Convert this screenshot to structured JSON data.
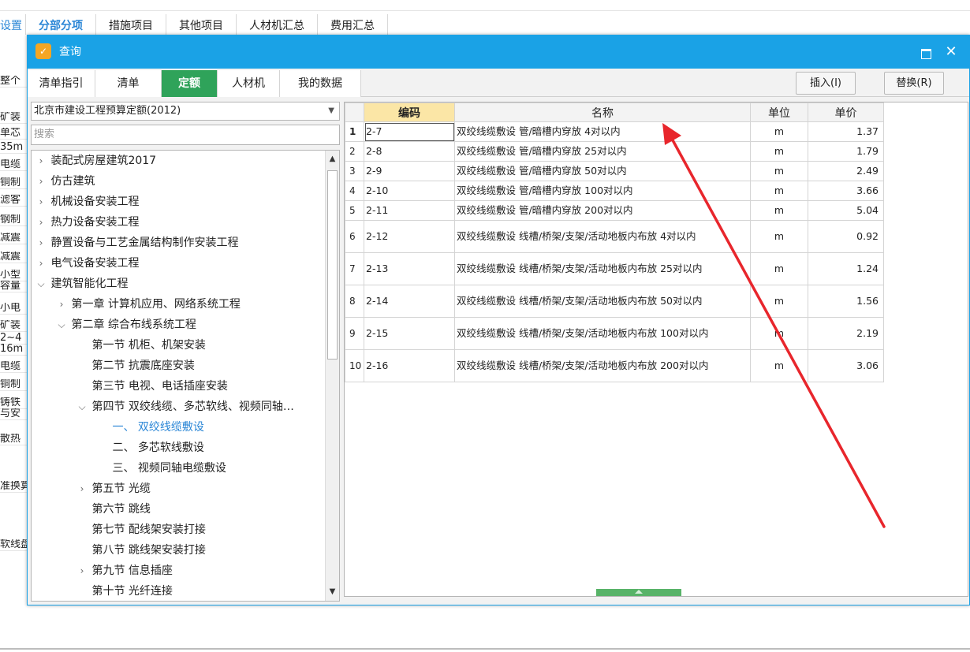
{
  "background": {
    "tabs": [
      "设置",
      "分部分项",
      "措施项目",
      "其他项目",
      "人材机汇总",
      "费用汇总"
    ],
    "active_tab": "分部分项",
    "left_cells": [
      "整个",
      "矿装",
      "单芯",
      "35m",
      "电缆",
      "铜制",
      "滤客",
      "钢制",
      "减震",
      "减震",
      "小型",
      "容量",
      "小电",
      "矿装",
      "2~4",
      "16m",
      "电缆",
      "铜制",
      "铸铁",
      "与安",
      "散热",
      "准换算",
      "软线盘"
    ]
  },
  "dialog": {
    "title": "查询",
    "app_icon": "app-logo-icon",
    "tabs": [
      "清单指引",
      "清单",
      "定额",
      "人材机",
      "我的数据"
    ],
    "active_tab": "定额",
    "insert_button": "插入(I)",
    "replace_button": "替换(R)",
    "quota_library": "北京市建设工程预算定额(2012)",
    "search_placeholder": "搜索",
    "tree": [
      {
        "label": "装配式房屋建筑2017",
        "indent": 0,
        "toggle": ">"
      },
      {
        "label": "仿古建筑",
        "indent": 0,
        "toggle": ">"
      },
      {
        "label": "机械设备安装工程",
        "indent": 0,
        "toggle": ">"
      },
      {
        "label": "热力设备安装工程",
        "indent": 0,
        "toggle": ">"
      },
      {
        "label": "静置设备与工艺金属结构制作安装工程",
        "indent": 0,
        "toggle": ">"
      },
      {
        "label": "电气设备安装工程",
        "indent": 0,
        "toggle": ">"
      },
      {
        "label": "建筑智能化工程",
        "indent": 0,
        "toggle": "v"
      },
      {
        "label": "第一章 计算机应用、网络系统工程",
        "indent": 1,
        "toggle": ">"
      },
      {
        "label": "第二章 综合布线系统工程",
        "indent": 1,
        "toggle": "v"
      },
      {
        "label": "第一节 机柜、机架安装",
        "indent": 2,
        "toggle": ""
      },
      {
        "label": "第二节 抗震底座安装",
        "indent": 2,
        "toggle": ""
      },
      {
        "label": "第三节 电视、电话插座安装",
        "indent": 2,
        "toggle": ""
      },
      {
        "label": "第四节 双绞线缆、多芯软线、视频同轴…",
        "indent": 2,
        "toggle": "v"
      },
      {
        "label": "一、 双绞线缆敷设",
        "indent": 3,
        "toggle": "",
        "selected": true
      },
      {
        "label": "二、 多芯软线敷设",
        "indent": 3,
        "toggle": ""
      },
      {
        "label": "三、 视频同轴电缆敷设",
        "indent": 3,
        "toggle": ""
      },
      {
        "label": "第五节 光缆",
        "indent": 2,
        "toggle": ">"
      },
      {
        "label": "第六节 跳线",
        "indent": 2,
        "toggle": ""
      },
      {
        "label": "第七节 配线架安装打接",
        "indent": 2,
        "toggle": ""
      },
      {
        "label": "第八节 跳线架安装打接",
        "indent": 2,
        "toggle": ""
      },
      {
        "label": "第九节 信息插座",
        "indent": 2,
        "toggle": ">"
      },
      {
        "label": "第十节 光纤连接",
        "indent": 2,
        "toggle": ""
      }
    ],
    "grid": {
      "columns": [
        "",
        "编码",
        "名称",
        "单位",
        "单价"
      ],
      "rows": [
        {
          "idx": "1",
          "code": "2-7",
          "name": "双绞线缆敷设 管/暗槽内穿放 4对以内",
          "unit": "m",
          "price": "1.37"
        },
        {
          "idx": "2",
          "code": "2-8",
          "name": "双绞线缆敷设 管/暗槽内穿放 25对以内",
          "unit": "m",
          "price": "1.79"
        },
        {
          "idx": "3",
          "code": "2-9",
          "name": "双绞线缆敷设 管/暗槽内穿放 50对以内",
          "unit": "m",
          "price": "2.49"
        },
        {
          "idx": "4",
          "code": "2-10",
          "name": "双绞线缆敷设 管/暗槽内穿放 100对以内",
          "unit": "m",
          "price": "3.66"
        },
        {
          "idx": "5",
          "code": "2-11",
          "name": "双绞线缆敷设 管/暗槽内穿放 200对以内",
          "unit": "m",
          "price": "5.04"
        },
        {
          "idx": "6",
          "code": "2-12",
          "name": "双绞线缆敷设 线槽/桥架/支架/活动地板内布放 4对以内",
          "unit": "m",
          "price": "0.92"
        },
        {
          "idx": "7",
          "code": "2-13",
          "name": "双绞线缆敷设 线槽/桥架/支架/活动地板内布放 25对以内",
          "unit": "m",
          "price": "1.24"
        },
        {
          "idx": "8",
          "code": "2-14",
          "name": "双绞线缆敷设 线槽/桥架/支架/活动地板内布放 50对以内",
          "unit": "m",
          "price": "1.56"
        },
        {
          "idx": "9",
          "code": "2-15",
          "name": "双绞线缆敷设 线槽/桥架/支架/活动地板内布放 100对以内",
          "unit": "m",
          "price": "2.19"
        },
        {
          "idx": "10",
          "code": "2-16",
          "name": "双绞线缆敷设 线槽/桥架/支架/活动地板内布放 200对以内",
          "unit": "m",
          "price": "3.06"
        }
      ]
    },
    "annotation_color": "#e8262c"
  }
}
